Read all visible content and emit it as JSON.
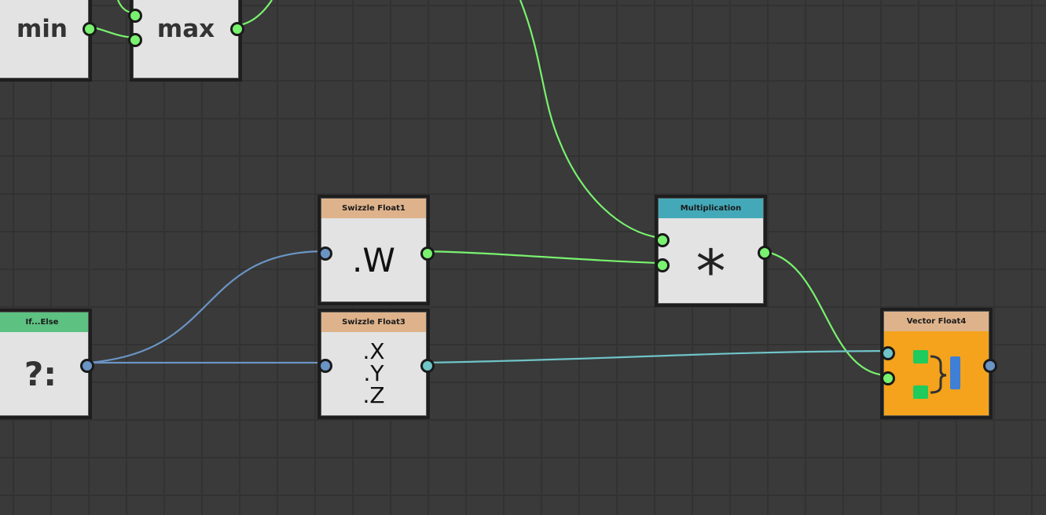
{
  "nodes": {
    "min": {
      "label": "min"
    },
    "max": {
      "label": "max"
    },
    "if_else": {
      "title": "If...Else",
      "symbol": "?:"
    },
    "swizzle_float1": {
      "title": "Swizzle Float1",
      "symbol": ".W"
    },
    "swizzle_float3": {
      "title": "Swizzle Float3",
      "line1": ".X",
      "line2": ".Y",
      "line3": ".Z"
    },
    "multiplication": {
      "title": "Multiplication",
      "symbol": "*"
    },
    "vector_float4": {
      "title": "Vector Float4"
    }
  },
  "colors": {
    "background": "#3a3a3a",
    "grid": "#323232",
    "wire_float": "#79f26f",
    "wire_bool": "#6a94c4",
    "wire_float3": "#6fc4c8",
    "header_swizzle": "#deb38b",
    "header_math": "#43a9b8",
    "header_logic": "#5cc181",
    "header_vector": "#deb38b",
    "vector_body": "#f5a31c"
  }
}
